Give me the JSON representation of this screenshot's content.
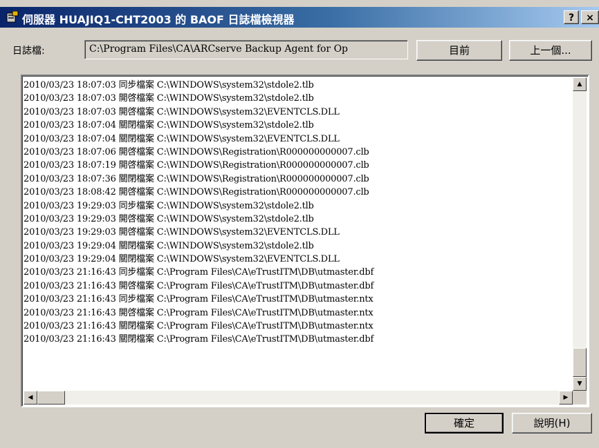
{
  "window": {
    "title": "伺服器 HUAJIQ1-CHT2003 的 BAOF 日誌檔檢視器",
    "help_glyph": "?",
    "close_glyph": "×",
    "title_icon": "server-icon"
  },
  "logfile": {
    "label": "日誌檔:",
    "path": "C:\\Program Files\\CA\\ARCserve Backup Agent for Op"
  },
  "buttons": {
    "current": "目前",
    "previous": "上一個...",
    "ok": "確定",
    "help": "說明(H)"
  },
  "log_lines": [
    "2010/03/23 18:07:03 同步檔案 C:\\WINDOWS\\system32\\stdole2.tlb",
    "2010/03/23 18:07:03 開啓檔案 C:\\WINDOWS\\system32\\stdole2.tlb",
    "2010/03/23 18:07:03 開啓檔案 C:\\WINDOWS\\system32\\EVENTCLS.DLL",
    "2010/03/23 18:07:04 關閉檔案 C:\\WINDOWS\\system32\\stdole2.tlb",
    "2010/03/23 18:07:04 關閉檔案 C:\\WINDOWS\\system32\\EVENTCLS.DLL",
    "2010/03/23 18:07:06 開啓檔案 C:\\WINDOWS\\Registration\\R000000000007.clb",
    "2010/03/23 18:07:19 開啓檔案 C:\\WINDOWS\\Registration\\R000000000007.clb",
    "2010/03/23 18:07:36 關閉檔案 C:\\WINDOWS\\Registration\\R000000000007.clb",
    "2010/03/23 18:08:42 開啓檔案 C:\\WINDOWS\\Registration\\R000000000007.clb",
    "2010/03/23 19:29:03 同步檔案 C:\\WINDOWS\\system32\\stdole2.tlb",
    "2010/03/23 19:29:03 開啓檔案 C:\\WINDOWS\\system32\\stdole2.tlb",
    "2010/03/23 19:29:03 開啓檔案 C:\\WINDOWS\\system32\\EVENTCLS.DLL",
    "2010/03/23 19:29:04 關閉檔案 C:\\WINDOWS\\system32\\stdole2.tlb",
    "2010/03/23 19:29:04 關閉檔案 C:\\WINDOWS\\system32\\EVENTCLS.DLL",
    "2010/03/23 21:16:43 同步檔案 C:\\Program Files\\CA\\eTrustITM\\DB\\utmaster.dbf",
    "2010/03/23 21:16:43 開啓檔案 C:\\Program Files\\CA\\eTrustITM\\DB\\utmaster.dbf",
    "2010/03/23 21:16:43 同步檔案 C:\\Program Files\\CA\\eTrustITM\\DB\\utmaster.ntx",
    "2010/03/23 21:16:43 開啓檔案 C:\\Program Files\\CA\\eTrustITM\\DB\\utmaster.ntx",
    "2010/03/23 21:16:43 關閉檔案 C:\\Program Files\\CA\\eTrustITM\\DB\\utmaster.ntx",
    "2010/03/23 21:16:43 關閉檔案 C:\\Program Files\\CA\\eTrustITM\\DB\\utmaster.dbf"
  ],
  "scrollbar": {
    "up_glyph": "▲",
    "down_glyph": "▼",
    "left_glyph": "◀",
    "right_glyph": "▶"
  }
}
